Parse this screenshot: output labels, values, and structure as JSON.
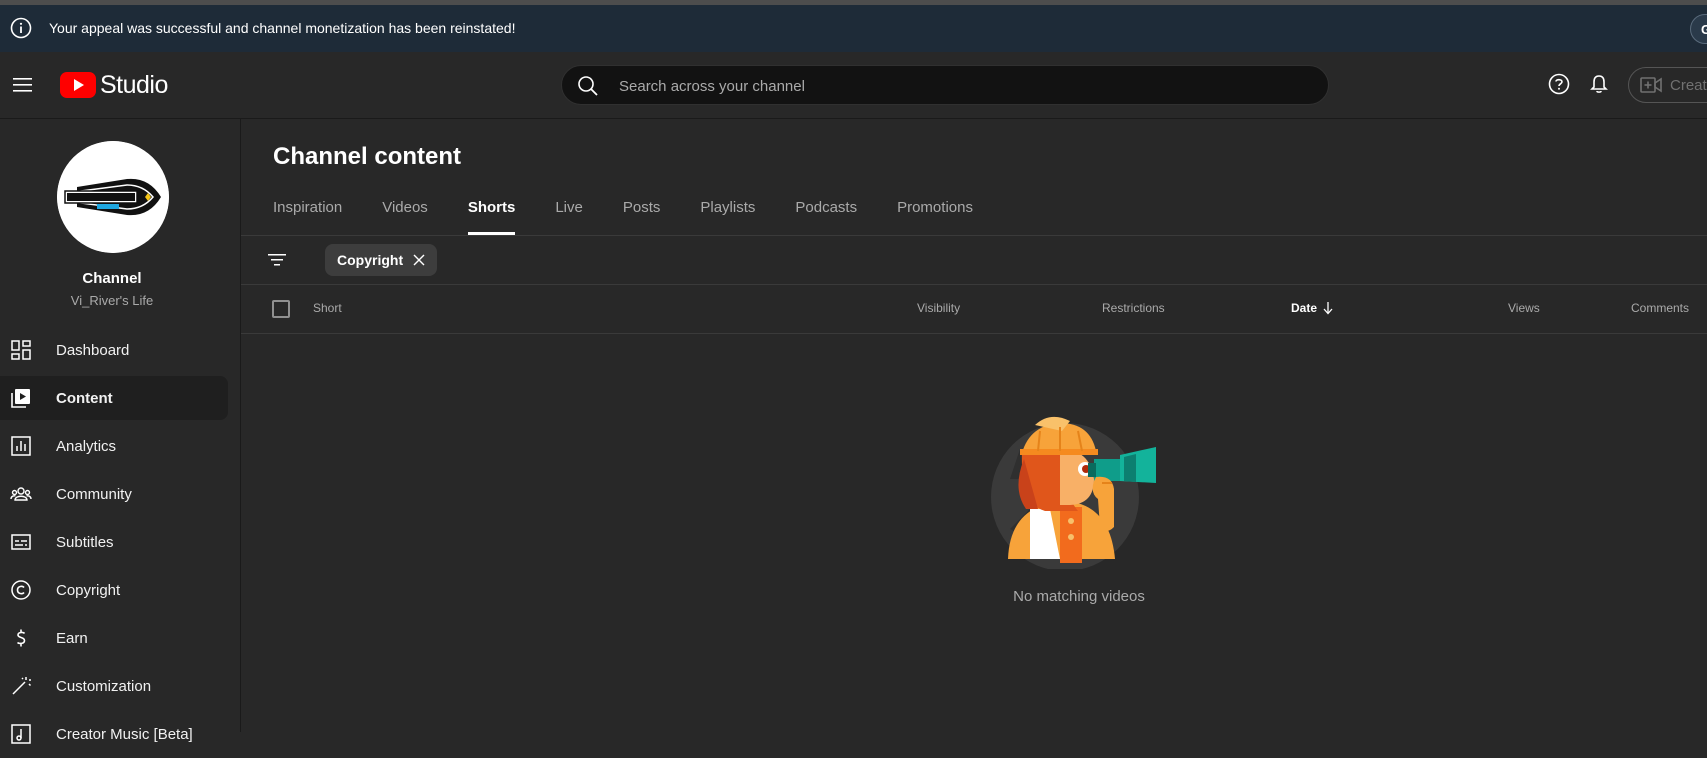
{
  "banner": {
    "message": "Your appeal was successful and channel monetization has been reinstated!",
    "cta": "G"
  },
  "header": {
    "logo_text": "Studio",
    "search_placeholder": "Search across your channel",
    "create_label": "Create"
  },
  "channel": {
    "title": "Channel",
    "name": "Vi_River's Life"
  },
  "sidebar": {
    "items": [
      {
        "label": "Dashboard",
        "icon": "dashboard-icon"
      },
      {
        "label": "Content",
        "icon": "content-icon",
        "active": true
      },
      {
        "label": "Analytics",
        "icon": "analytics-icon"
      },
      {
        "label": "Community",
        "icon": "community-icon"
      },
      {
        "label": "Subtitles",
        "icon": "subtitles-icon"
      },
      {
        "label": "Copyright",
        "icon": "copyright-icon"
      },
      {
        "label": "Earn",
        "icon": "earn-icon"
      },
      {
        "label": "Customization",
        "icon": "customization-icon"
      },
      {
        "label": "Creator Music [Beta]",
        "icon": "creator-music-icon"
      }
    ]
  },
  "main": {
    "title": "Channel content",
    "tabs": [
      {
        "label": "Inspiration"
      },
      {
        "label": "Videos"
      },
      {
        "label": "Shorts",
        "active": true
      },
      {
        "label": "Live"
      },
      {
        "label": "Posts"
      },
      {
        "label": "Playlists"
      },
      {
        "label": "Podcasts"
      },
      {
        "label": "Promotions"
      }
    ],
    "filter_chip": "Copyright",
    "columns": {
      "short": "Short",
      "visibility": "Visibility",
      "restrictions": "Restrictions",
      "date": "Date",
      "views": "Views",
      "comments": "Comments"
    },
    "empty_message": "No matching videos"
  },
  "colors": {
    "background": "#282828",
    "banner": "#1e2b38",
    "brand_red": "#ff0000",
    "illustration_orange": "#f7941d",
    "illustration_teal": "#0f9d8a"
  }
}
